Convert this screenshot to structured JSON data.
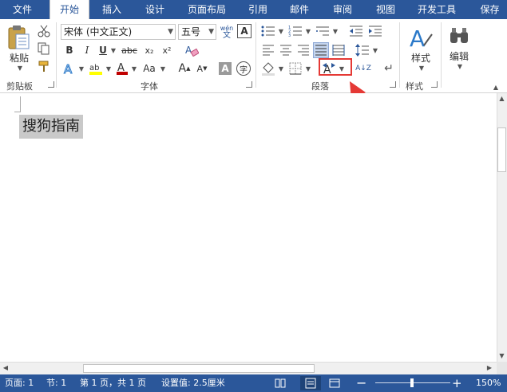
{
  "tabs": [
    {
      "label": "文件"
    },
    {
      "label": "开始"
    },
    {
      "label": "插入"
    },
    {
      "label": "设计"
    },
    {
      "label": "页面布局"
    },
    {
      "label": "引用"
    },
    {
      "label": "邮件"
    },
    {
      "label": "审阅"
    },
    {
      "label": "视图"
    },
    {
      "label": "开发工具"
    },
    {
      "label": "保存"
    }
  ],
  "clipboard": {
    "paste_label": "粘贴",
    "group_label": "剪贴板"
  },
  "font": {
    "font_name": "宋体 (中文正文)",
    "font_size": "五号",
    "bold": "B",
    "italic": "I",
    "underline": "U",
    "strike": "abc",
    "sub": "x₂",
    "sup": "x²",
    "grow": "A",
    "shrink": "A",
    "case": "Aa",
    "phonetic": "wén",
    "phonetic_sub": "文",
    "char_border": "A",
    "char_shade": "A",
    "enclose": "字",
    "group_label": "字体"
  },
  "paragraph": {
    "group_label": "段落",
    "sort": "A↓Z"
  },
  "styles": {
    "label": "样式",
    "group_label": "样式"
  },
  "editing": {
    "label": "编辑"
  },
  "document": {
    "text": "搜狗指南"
  },
  "status": {
    "page": "页面: 1",
    "section": "节: 1",
    "pages": "第 1 页，共 1 页",
    "setting": "设置值: 2.5厘米",
    "zoom": "150%"
  },
  "colors": {
    "accent": "#2b579a",
    "highlight": "#e53935"
  }
}
